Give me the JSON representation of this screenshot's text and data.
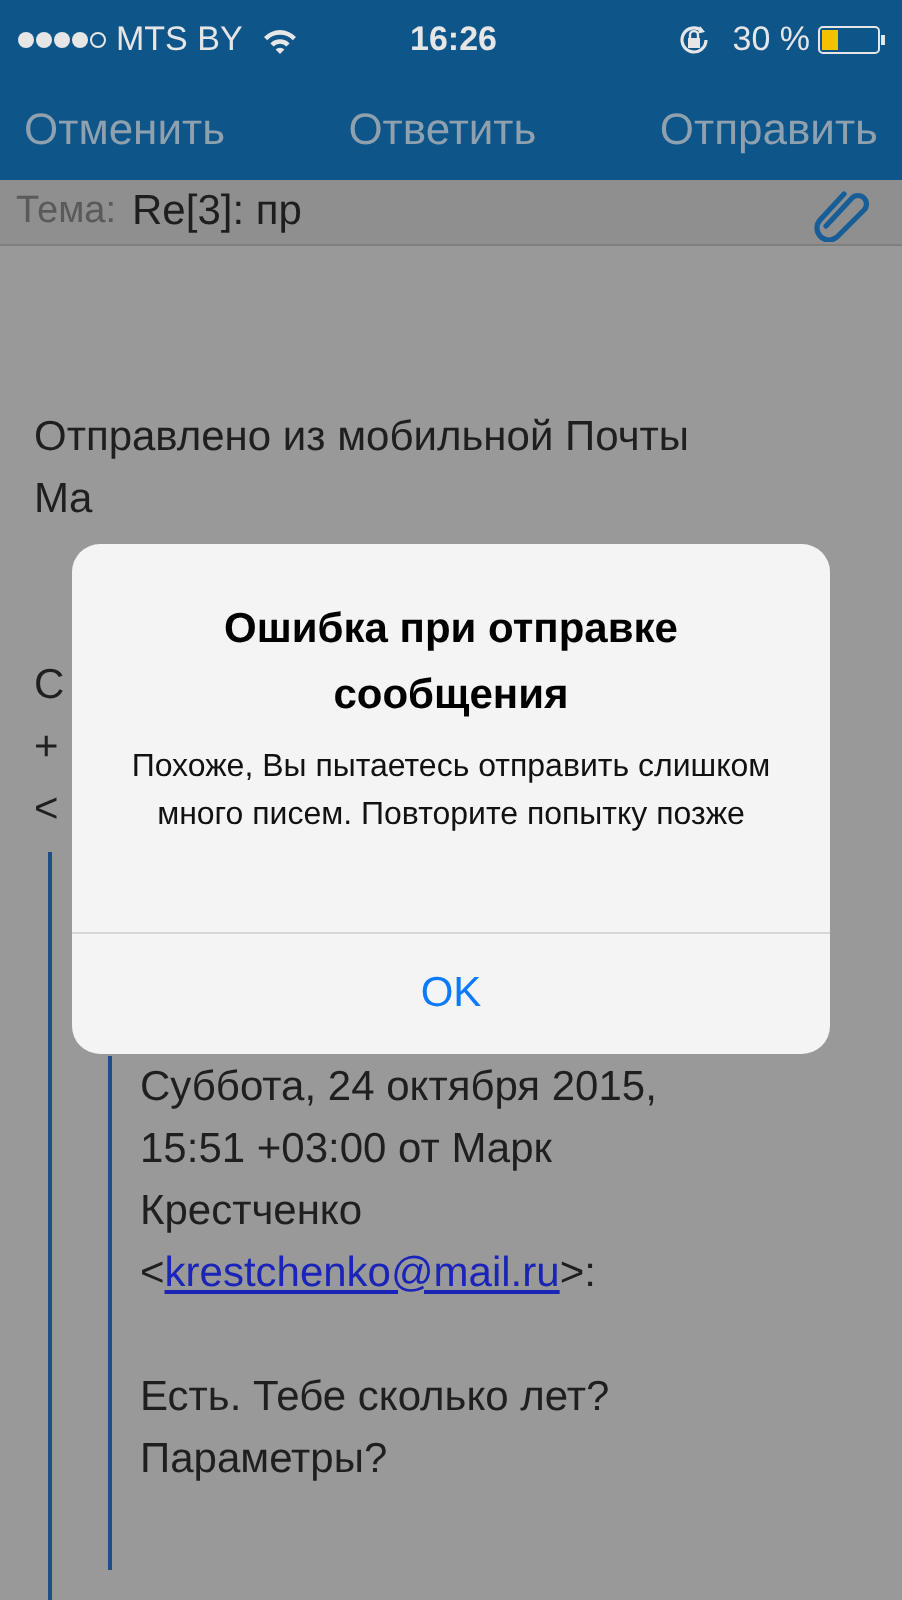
{
  "status_bar": {
    "carrier": "MTS BY",
    "time": "16:26",
    "battery_text": "30 %"
  },
  "nav_bar": {
    "buttons": [
      "Отменить",
      "Ответить",
      "Отправить"
    ]
  },
  "subject": {
    "label": "Тема:",
    "value": "Re[3]: пр"
  },
  "body": {
    "signature_lines": [
      "Отправлено из мобильной Почты",
      "Ma"
    ],
    "covered_lines": [
      "С",
      "+",
      "<"
    ],
    "quote": {
      "header_lines": [
        "Суббота, 24 октября 2015,",
        "15:51 +03:00 от Марк",
        "Крестченко"
      ],
      "email_line": {
        "before": "<",
        "link": "krestchenko@mail.ru",
        "after": ">:"
      },
      "message_lines": [
        "Есть. Тебе сколько лет?",
        "Параметры?"
      ]
    }
  },
  "alert": {
    "title": "Ошибка при отправке сообщения",
    "message": "Похоже, Вы пытаетесь отправить слишком много писем. Повторите попытку позже",
    "button": "OK"
  }
}
